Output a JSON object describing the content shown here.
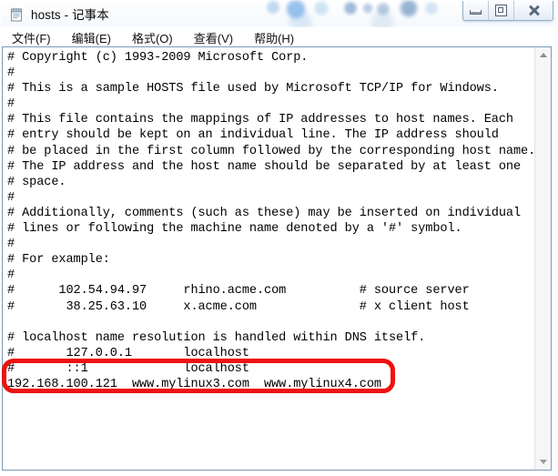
{
  "window": {
    "title": "hosts - 记事本",
    "icon": "notepad-icon",
    "controls": {
      "minimize_label": "最小化",
      "restore_label": "向下还原",
      "close_label": "关闭"
    }
  },
  "menu": {
    "items": [
      {
        "label": "文件(F)"
      },
      {
        "label": "编辑(E)"
      },
      {
        "label": "格式(O)"
      },
      {
        "label": "查看(V)"
      },
      {
        "label": "帮助(H)"
      }
    ]
  },
  "editor": {
    "content": "# Copyright (c) 1993-2009 Microsoft Corp.\n#\n# This is a sample HOSTS file used by Microsoft TCP/IP for Windows.\n#\n# This file contains the mappings of IP addresses to host names. Each\n# entry should be kept on an individual line. The IP address should\n# be placed in the first column followed by the corresponding host name.\n# The IP address and the host name should be separated by at least one\n# space.\n#\n# Additionally, comments (such as these) may be inserted on individual\n# lines or following the machine name denoted by a '#' symbol.\n#\n# For example:\n#\n#      102.54.94.97     rhino.acme.com          # source server\n#       38.25.63.10     x.acme.com              # x client host\n\n# localhost name resolution is handled within DNS itself.\n#       127.0.0.1       localhost\n#       ::1             localhost\n192.168.100.121  www.mylinux3.com  www.mylinux4.com",
    "highlighted_line": "192.168.100.121  www.mylinux3.com  www.mylinux4.com",
    "annotation_color": "#ee1111"
  },
  "scrollbar": {
    "up_arrow": "scroll-up-arrow",
    "down_arrow": "scroll-down-arrow"
  }
}
